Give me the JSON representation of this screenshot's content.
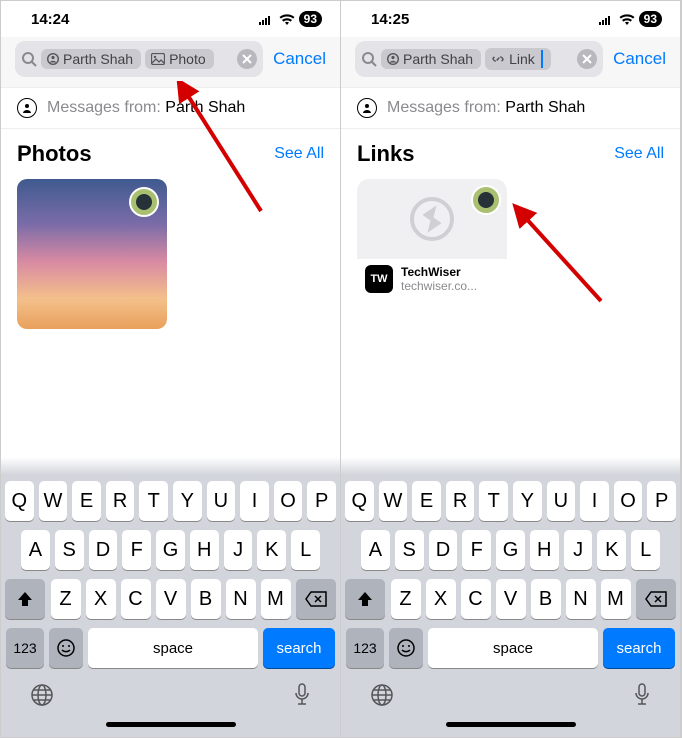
{
  "left": {
    "status": {
      "time": "14:24",
      "battery": "93"
    },
    "search": {
      "chip_person": "Parth Shah",
      "chip_type": "Photo",
      "cancel": "Cancel"
    },
    "from": {
      "label": "Messages from:",
      "name": "Parth Shah"
    },
    "section": {
      "title": "Photos",
      "see_all": "See All"
    }
  },
  "right": {
    "status": {
      "time": "14:25",
      "battery": "93"
    },
    "search": {
      "chip_person": "Parth Shah",
      "chip_type": "Link",
      "cancel": "Cancel"
    },
    "from": {
      "label": "Messages from:",
      "name": "Parth Shah"
    },
    "section": {
      "title": "Links",
      "see_all": "See All"
    },
    "link_card": {
      "title": "TechWiser",
      "subtitle": "techwiser.co...",
      "icon_text": "TW"
    }
  },
  "keyboard": {
    "row1": [
      "Q",
      "W",
      "E",
      "R",
      "T",
      "Y",
      "U",
      "I",
      "O",
      "P"
    ],
    "row2": [
      "A",
      "S",
      "D",
      "F",
      "G",
      "H",
      "J",
      "K",
      "L"
    ],
    "row3": [
      "Z",
      "X",
      "C",
      "V",
      "B",
      "N",
      "M"
    ],
    "num": "123",
    "space": "space",
    "search": "search"
  }
}
